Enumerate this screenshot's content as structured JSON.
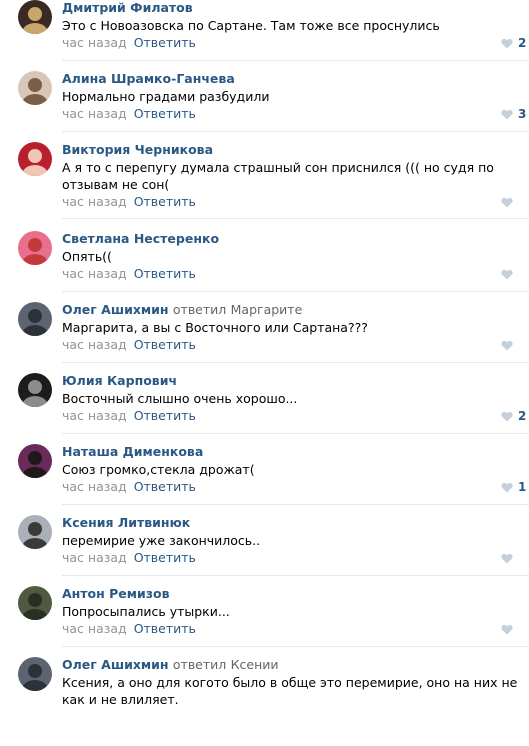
{
  "colors": {
    "author": "#2a5885",
    "meta": "#939393",
    "divider": "#e7e8ec",
    "like_icon": "#c5d0db"
  },
  "icons": {
    "like": "heart-icon"
  },
  "comments": [
    {
      "author": "Дмитрий Филатов",
      "replied": "",
      "reply_to": "",
      "text": "Это с Новоазовска по Сартане. Там тоже все проснулись",
      "time": "час назад",
      "reply_label": "Ответить",
      "likes": "2",
      "avatar": {
        "bg": "#3b2a24",
        "fg": "#c9a66b"
      }
    },
    {
      "author": "Алина Шрамко-Ганчева",
      "replied": "",
      "reply_to": "",
      "text": "Нормально градами разбудили",
      "time": "час назад",
      "reply_label": "Ответить",
      "likes": "3",
      "avatar": {
        "bg": "#d8c7b8",
        "fg": "#7a5e4a"
      }
    },
    {
      "author": "Виктория Черникова",
      "replied": "",
      "reply_to": "",
      "text": "А я то с перепугу думала страшный сон приснился ((( но судя по отзывам не сон(",
      "time": "час назад",
      "reply_label": "Ответить",
      "likes": "",
      "avatar": {
        "bg": "#b8202e",
        "fg": "#f2c6b4"
      }
    },
    {
      "author": "Светлана Нестеренко",
      "replied": "",
      "reply_to": "",
      "text": "Опять((",
      "time": "час назад",
      "reply_label": "Ответить",
      "likes": "",
      "avatar": {
        "bg": "#e86f8e",
        "fg": "#c23a3a"
      }
    },
    {
      "author": "Олег Ашихмин",
      "replied": "ответил",
      "reply_to": "Маргарите",
      "text": "Маргарита, а вы с Восточного или Сартана???",
      "time": "час назад",
      "reply_label": "Ответить",
      "likes": "",
      "avatar": {
        "bg": "#5b6470",
        "fg": "#2d3238"
      }
    },
    {
      "author": "Юлия Карпович",
      "replied": "",
      "reply_to": "",
      "text": "Восточный слышно очень хорошо...",
      "time": "час назад",
      "reply_label": "Ответить",
      "likes": "2",
      "avatar": {
        "bg": "#1c1c1c",
        "fg": "#8c8c8c"
      }
    },
    {
      "author": "Наташа Дименкова",
      "replied": "",
      "reply_to": "",
      "text": "Союз громко,стекла дрожат(",
      "time": "час назад",
      "reply_label": "Ответить",
      "likes": "1",
      "avatar": {
        "bg": "#6b2a5a",
        "fg": "#1e1a1c"
      }
    },
    {
      "author": "Ксения Литвинюк",
      "replied": "",
      "reply_to": "",
      "text": "перемирие уже закончилось..",
      "time": "час назад",
      "reply_label": "Ответить",
      "likes": "",
      "avatar": {
        "bg": "#a9b0b8",
        "fg": "#3a3a3a"
      }
    },
    {
      "author": "Антон Ремизов",
      "replied": "",
      "reply_to": "",
      "text": "Попросыпались утырки...",
      "time": "час назад",
      "reply_label": "Ответить",
      "likes": "",
      "avatar": {
        "bg": "#4f5a40",
        "fg": "#2a2f24"
      }
    },
    {
      "author": "Олег Ашихмин",
      "replied": "ответил",
      "reply_to": "Ксении",
      "text": "Ксения, а оно для когото было в обще это перемирие, оно на них не как и не влиляет.",
      "time": "",
      "reply_label": "",
      "likes": "",
      "avatar": {
        "bg": "#5b6470",
        "fg": "#2d3238"
      }
    }
  ]
}
